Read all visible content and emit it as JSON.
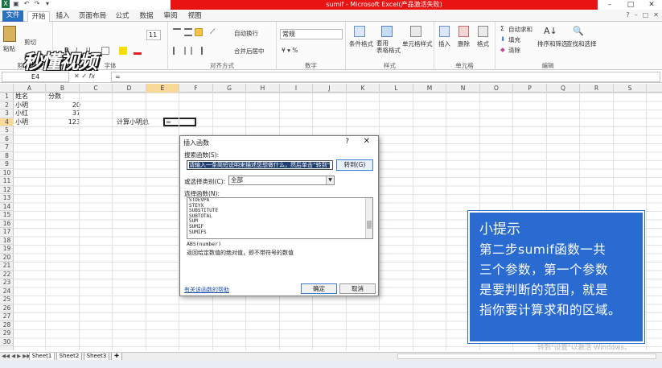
{
  "window": {
    "title": "sumif - Microsoft Excel(产品激活失败)"
  },
  "tabs": [
    "文件",
    "开始",
    "插入",
    "页面布局",
    "公式",
    "数据",
    "审阅",
    "视图"
  ],
  "logo": "秒懂视频",
  "ribbon": {
    "clipboard": {
      "paste": "粘贴",
      "cut": "剪切",
      "format_painter": "格式刷",
      "group": "剪贴板"
    },
    "font": {
      "size": "11",
      "bold": "B",
      "italic": "I",
      "underline": "U",
      "group": "字体"
    },
    "alignment": {
      "wrap": "自动换行",
      "merge": "合并后居中",
      "group": "对齐方式"
    },
    "number": {
      "format": "常规",
      "group": "数字"
    },
    "styles": {
      "conditional": "条件格式",
      "table": "套用\n表格格式",
      "cell": "单元格样式",
      "group": "样式"
    },
    "cells": {
      "insert": "插入",
      "delete": "删除",
      "format": "格式",
      "group": "单元格"
    },
    "editing": {
      "autosum": "自动求和",
      "fill": "填充",
      "clear": "清除",
      "sort": "排序和筛选",
      "find": "查找和选择",
      "group": "编辑"
    }
  },
  "formula_bar": {
    "name_box": "E4",
    "fx": "fx",
    "content": "="
  },
  "columns": [
    "A",
    "B",
    "C",
    "D",
    "E",
    "F",
    "G",
    "H",
    "I",
    "J",
    "K",
    "L",
    "M",
    "N",
    "O",
    "P",
    "Q",
    "R",
    "S"
  ],
  "rows": [
    "1",
    "2",
    "3",
    "4",
    "5",
    "6",
    "7",
    "8",
    "9",
    "10",
    "11",
    "12",
    "13",
    "14",
    "15",
    "16",
    "17",
    "18",
    "19",
    "20",
    "21",
    "22",
    "23",
    "24",
    "25",
    "26",
    "27",
    "28",
    "29",
    "30"
  ],
  "cells": {
    "a1": "姓名",
    "b1": "分数",
    "a2": "小明",
    "b2": "20",
    "a3": "小红",
    "b3": "37",
    "a4": "小明",
    "b4": "123",
    "d4": "计算小明总",
    "e4": "="
  },
  "dialog": {
    "title": "插入函数",
    "help_q": "?",
    "close": "✕",
    "search_label": "搜索函数(S):",
    "search_value": "请输入一条简短说明来描述您想做什么，然后单击“转到”",
    "go_button": "转到(G)",
    "category_label": "或选择类别(C):",
    "category_value": "全部",
    "list_label": "选择函数(N):",
    "functions": [
      "STDEVPA",
      "STEYX",
      "SUBSTITUTE",
      "SUBTOTAL",
      "SUM",
      "SUMIF",
      "SUMIFS"
    ],
    "signature": "ABS(number)",
    "description": "返回给定数值的绝对值，即不带符号的数值",
    "help_link": "有关该函数的帮助",
    "ok": "确定",
    "cancel": "取消"
  },
  "tip": {
    "title": "小提示",
    "lines": [
      "第二步sumif函数一共",
      "三个参数，第一个参数",
      "是要判断的范围，就是",
      "指你要计算求和的区域。"
    ]
  },
  "sheets": [
    "Sheet1",
    "Sheet2",
    "Sheet3"
  ],
  "watermark": "转到\"设置\"以激活 Windows。",
  "colors": {
    "title_red": "#e81313",
    "file_tab": "#2a6fc0",
    "tip_bg": "#2a6bd2",
    "selected_header": "#f9d99a"
  }
}
